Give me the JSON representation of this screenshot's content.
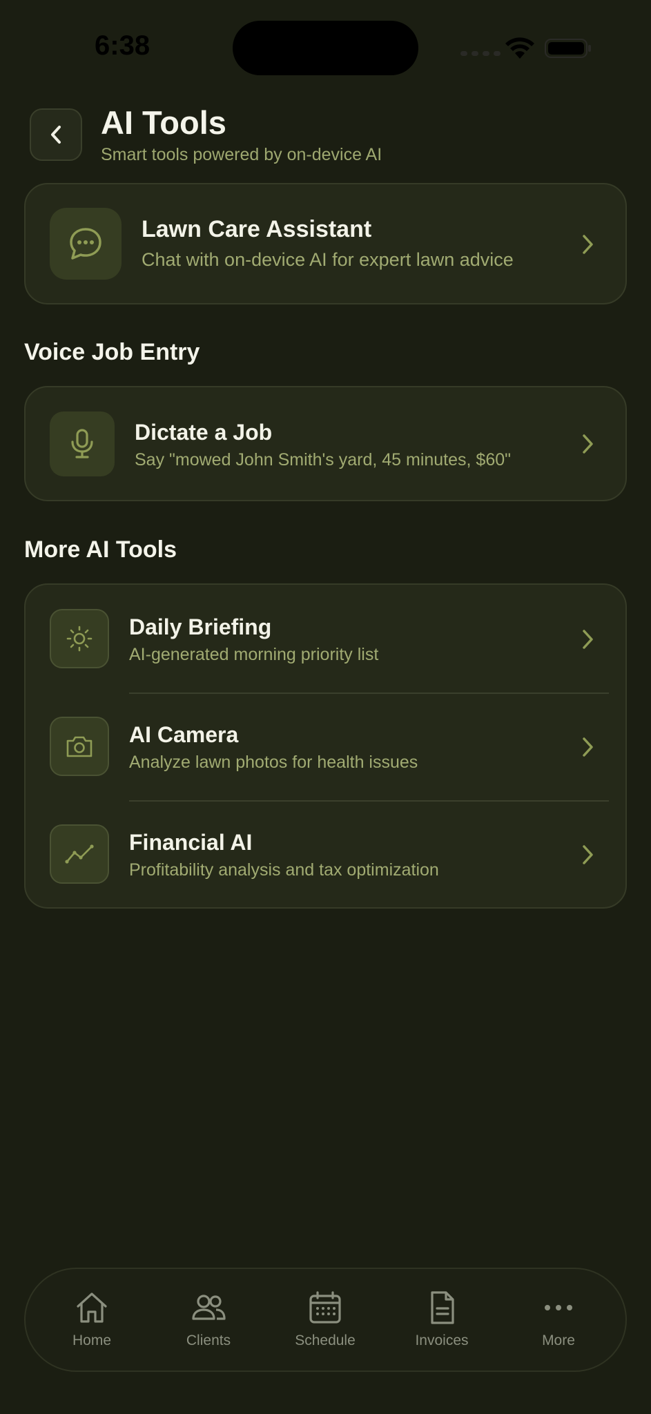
{
  "status_bar": {
    "time": "6:38"
  },
  "header": {
    "title": "AI Tools",
    "subtitle": "Smart tools powered by on-device AI"
  },
  "assistant": {
    "title": "Lawn Care Assistant",
    "subtitle": "Chat with on-device AI for expert lawn advice",
    "icon": "chat-bubble-icon"
  },
  "voice_section": {
    "heading": "Voice Job Entry",
    "item": {
      "title": "Dictate a Job",
      "subtitle": "Say \"mowed John Smith's yard, 45 minutes, $60\"",
      "icon": "microphone-icon"
    }
  },
  "more_section": {
    "heading": "More AI Tools",
    "items": [
      {
        "title": "Daily Briefing",
        "subtitle": "AI-generated morning priority list",
        "icon": "sun-icon"
      },
      {
        "title": "AI Camera",
        "subtitle": "Analyze lawn photos for health issues",
        "icon": "camera-icon"
      },
      {
        "title": "Financial AI",
        "subtitle": "Profitability analysis and tax optimization",
        "icon": "trend-line-icon"
      }
    ]
  },
  "tab_bar": {
    "tabs": [
      {
        "label": "Home",
        "icon": "home-icon"
      },
      {
        "label": "Clients",
        "icon": "users-icon"
      },
      {
        "label": "Schedule",
        "icon": "calendar-icon"
      },
      {
        "label": "Invoices",
        "icon": "document-icon"
      },
      {
        "label": "More",
        "icon": "more-dots-icon"
      }
    ]
  },
  "colors": {
    "background": "#1b1e12",
    "card": "#252919",
    "accent": "#9ea870",
    "icon_tile": "#363d22"
  }
}
